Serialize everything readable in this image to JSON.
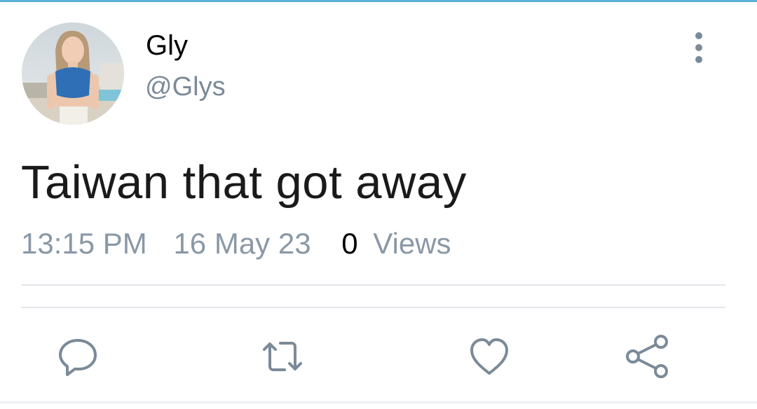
{
  "tweet": {
    "author": {
      "display_name": "Gly",
      "handle": "@Glys"
    },
    "text": "Taiwan that got away",
    "time": "13:15 PM",
    "date": "16 May 23",
    "views_count": "0",
    "views_label": "Views"
  },
  "icons": {
    "more": "more-vertical-icon",
    "reply": "reply-icon",
    "retweet": "retweet-icon",
    "like": "heart-icon",
    "share": "share-icon"
  },
  "colors": {
    "muted": "#7b8a98",
    "text": "#1a1a1a",
    "accent": "#5ab0d6"
  }
}
